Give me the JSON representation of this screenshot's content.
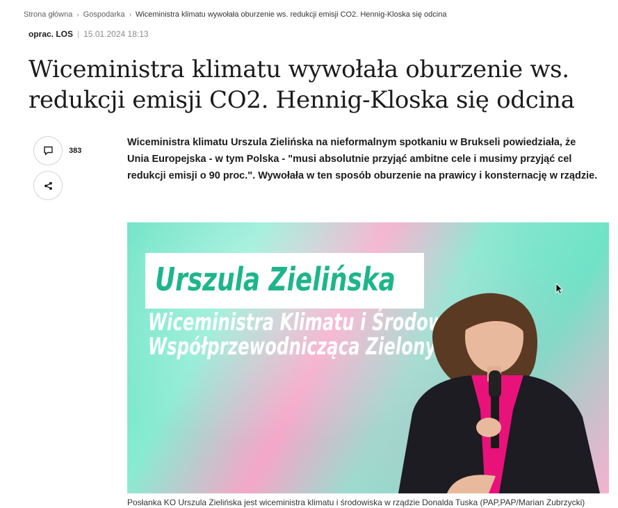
{
  "breadcrumb": {
    "home": "Strona główna",
    "section": "Gospodarka",
    "current": "Wiceministra klimatu wywołała oburzenie ws. redukcji emisji CO2. Hennig-Kloska się odcina"
  },
  "meta": {
    "author": "oprac. LOS",
    "date": "15.01.2024 18:13"
  },
  "article": {
    "title": "Wiceministra klimatu wywołała oburzenie ws. redukcji emisji CO2. Hennig-Kloska się odcina",
    "lead": "Wiceministra klimatu Urszula Zielińska na nieformalnym spotkaniu w Brukseli powiedziała, że Unia Europejska - w tym Polska - \"musi absolutnie przyjąć ambitne cele i musimy przyjąć cel redukcji emisji o 90 proc.\". Wywołała w ten sposób oburzenie na prawicy i konsternację w rządzie.",
    "caption": "Posłanka KO Urszula Zielińska jest wiceministra klimatu i środowiska w rządzie Donalda Tuska (PAP,PAP/Marian Zubrzycki)"
  },
  "social": {
    "comment_count": "383",
    "comment_icon": "comment-icon",
    "share_icon": "share-icon"
  },
  "hero_image": {
    "banner_name": "Urszula Zielińska",
    "banner_line1": "Wiceministra Klimatu i Środowiska",
    "banner_line2": "Współprzewodnicząca Zielonych"
  },
  "colors": {
    "banner_name": "#1fb58c",
    "blouse": "#e8127a",
    "jacket": "#1c1c22"
  }
}
